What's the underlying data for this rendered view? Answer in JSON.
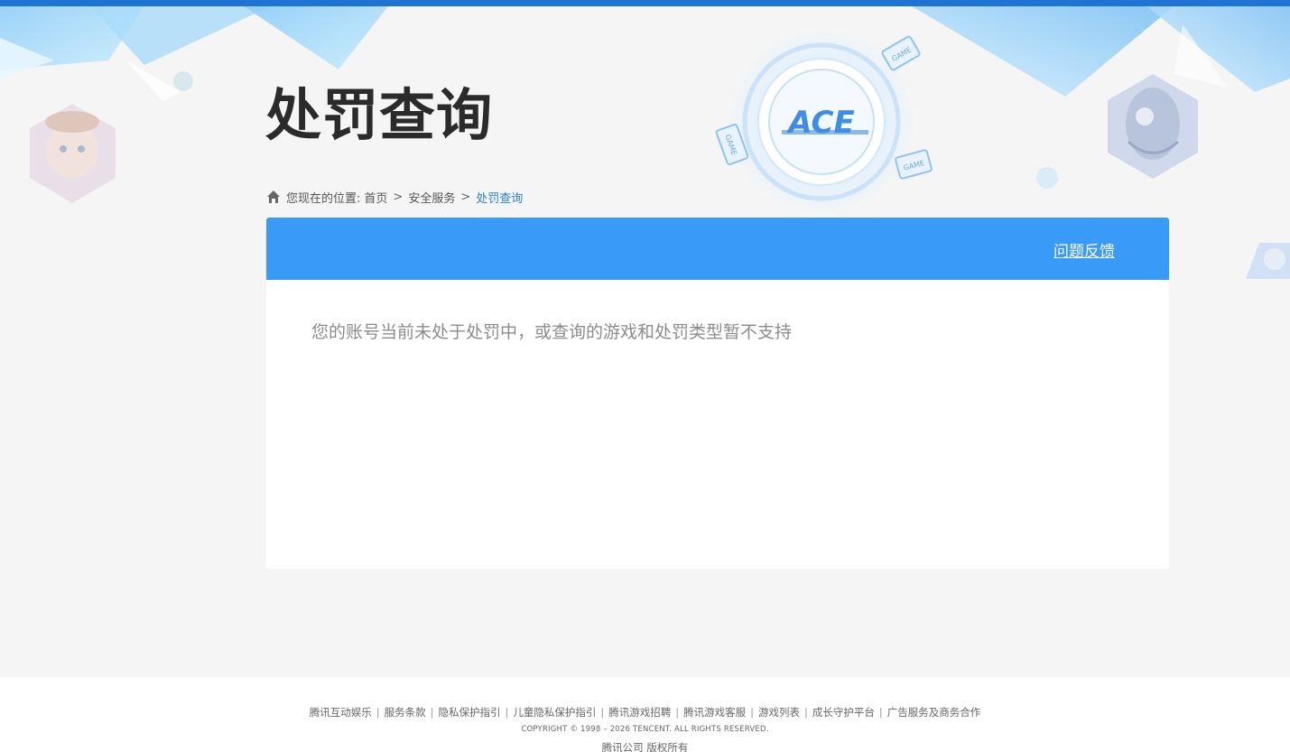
{
  "header": {
    "title": "处罚查询",
    "logo_text": "ACE",
    "badge_labels": [
      "GAME",
      "GAME",
      "GAME"
    ]
  },
  "breadcrumb": {
    "prefix": "您现在的位置:",
    "items": [
      "首页",
      "安全服务",
      "处罚查询"
    ],
    "separator": ">"
  },
  "panel": {
    "feedback_label": "问题反馈",
    "message": "您的账号当前未处于处罚中，或查询的游戏和处罚类型暂不支持"
  },
  "footer": {
    "links": [
      "腾讯互动娱乐",
      "服务条款",
      "隐私保护指引",
      "儿童隐私保护指引",
      "腾讯游戏招聘",
      "腾讯游戏客服",
      "游戏列表",
      "成长守护平台",
      "广告服务及商务合作"
    ],
    "link_divider": "|",
    "copyright": "COPYRIGHT © 1998 – 2026 TENCENT. ALL RIGHTS RESERVED.",
    "company": "腾讯公司 版权所有"
  },
  "colors": {
    "topbar": "#1f74d3",
    "panel_header": "#3a9af7",
    "breadcrumb_current": "#2a7fd4",
    "page_bg": "#f5f5f5"
  },
  "icons": [
    "home-icon",
    "ace-logo-icon"
  ]
}
